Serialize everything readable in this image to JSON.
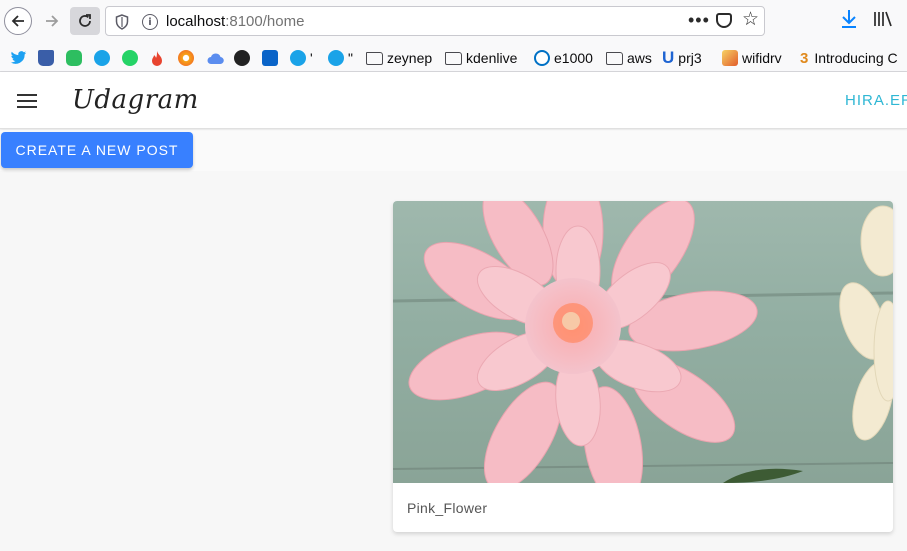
{
  "browser": {
    "url_host": "localhost",
    "url_port": ":8100/home"
  },
  "bookmarks": [
    {
      "label": "",
      "icon": "twitter-icon",
      "color": "#1da1f2"
    },
    {
      "label": "",
      "icon": "cup-icon",
      "color": "#3a5ea8"
    },
    {
      "label": "",
      "icon": "evernote-icon",
      "color": "#2dbe60"
    },
    {
      "label": "",
      "icon": "bip-icon",
      "color": "#1aa3e8"
    },
    {
      "label": "",
      "icon": "whatsapp-icon",
      "color": "#25d366"
    },
    {
      "label": "",
      "icon": "flame-icon",
      "color": "#e8442f"
    },
    {
      "label": "",
      "icon": "grafana-icon",
      "color": "#f7a318"
    },
    {
      "label": "",
      "icon": "cloud-icon",
      "color": "#5b8def"
    },
    {
      "label": "",
      "icon": "github-icon",
      "color": "#222222"
    },
    {
      "label": "",
      "icon": "outlook-icon",
      "color": "#0a64c8"
    },
    {
      "label": "'",
      "icon": "bip-icon",
      "color": "#1aa3e8"
    },
    {
      "label": "\"",
      "icon": "bip-icon",
      "color": "#1aa3e8"
    },
    {
      "label": "zeynep",
      "icon": "folder-icon"
    },
    {
      "label": "kdenlive",
      "icon": "folder-icon"
    },
    {
      "label": "e1000",
      "icon": "intel-icon",
      "color": "#0071c5"
    },
    {
      "label": "aws",
      "icon": "folder-icon"
    },
    {
      "label": "prj3",
      "icon": "u-icon",
      "color": "#1e64d2"
    },
    {
      "label": "wifidrv",
      "icon": "notepad-icon",
      "color": "#e25c2a"
    },
    {
      "label": "Introducing C",
      "icon": "ebook-icon",
      "color": "#e08a1e"
    }
  ],
  "app": {
    "title": "Udagram",
    "user": "HIRA.ER",
    "create_button": "CREATE A NEW POST"
  },
  "feed": [
    {
      "caption": "Pink_Flower",
      "image": "pink-flower-photo"
    }
  ]
}
